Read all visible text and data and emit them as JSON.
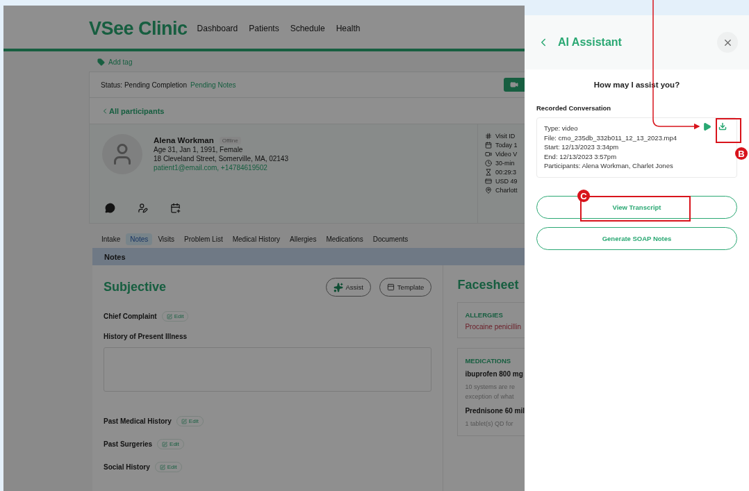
{
  "app": {
    "logo": "VSee Clinic",
    "nav": [
      "Dashboard",
      "Patients",
      "Schedule",
      "Health"
    ]
  },
  "add_tag": "Add tag",
  "status": {
    "label": "Status: Pending Completion",
    "value": "Pending Notes"
  },
  "back_link": "All participants",
  "patient": {
    "name": "Alena Workman",
    "badge": "Offline",
    "lines": [
      "Age 31, Jan 1, 1991, Female",
      "18 Cleveland Street, Somerville, MA, 02143"
    ],
    "contact": "patient1@email.com, +14784619502"
  },
  "visit_info": [
    {
      "kind": "hash",
      "text": "Visit ID"
    },
    {
      "kind": "calendar",
      "text": "Today 1"
    },
    {
      "kind": "video",
      "text": "Video V"
    },
    {
      "kind": "clock",
      "text": "30-min"
    },
    {
      "kind": "hourglass",
      "text": "00:29:3"
    },
    {
      "kind": "card",
      "text": "USD 49"
    },
    {
      "kind": "pin",
      "text": "Charlott"
    }
  ],
  "tabs": [
    {
      "label": "Intake",
      "selected": false
    },
    {
      "label": "Notes",
      "selected": true
    },
    {
      "label": "Visits",
      "selected": false
    },
    {
      "label": "Problem List",
      "selected": false
    },
    {
      "label": "Medical History",
      "selected": false
    },
    {
      "label": "Allergies",
      "selected": false
    },
    {
      "label": "Medications",
      "selected": false
    },
    {
      "label": "Documents",
      "selected": false
    }
  ],
  "section_bar": "Notes",
  "subjective": {
    "title": "Subjective",
    "assist": "Assist",
    "template": "Template",
    "fields": [
      {
        "kind": "edit",
        "label": "Chief Complaint",
        "action": "Edit"
      },
      {
        "kind": "textarea",
        "label": "History of Present Illness"
      },
      {
        "kind": "edit",
        "label": "Past Medical History",
        "action": "Edit"
      },
      {
        "kind": "edit",
        "label": "Past Surgeries",
        "action": "Edit"
      },
      {
        "kind": "edit",
        "label": "Social History",
        "action": "Edit"
      }
    ]
  },
  "facesheet": {
    "title": "Facesheet",
    "allergies": {
      "heading": "ALLERGIES",
      "items": [
        "Procaine penicillin"
      ]
    },
    "medications": {
      "heading": "MEDICATIONS",
      "items": [
        {
          "name": "ibuprofen 800 mg",
          "detail": [
            "10 systems are re",
            "exception of what"
          ]
        },
        {
          "name": "Prednisone 60 mil",
          "detail": [
            "1 tablet(s) QD for"
          ]
        }
      ]
    }
  },
  "assistant": {
    "title": "AI Assistant",
    "prompt": "How may I assist you?",
    "section": "Recorded Conversation",
    "recording": [
      "Type: video",
      "File: cmo_235db_332b011_12_13_2023.mp4",
      "Start: 12/13/2023 3:34pm",
      "End: 12/13/2023 3:57pm",
      "Participants: Alena Workman, Charlet Jones"
    ],
    "buttons": [
      "View Transcript",
      "Generate SOAP Notes"
    ]
  },
  "annotations": [
    {
      "label": "B"
    },
    {
      "label": "C"
    }
  ]
}
